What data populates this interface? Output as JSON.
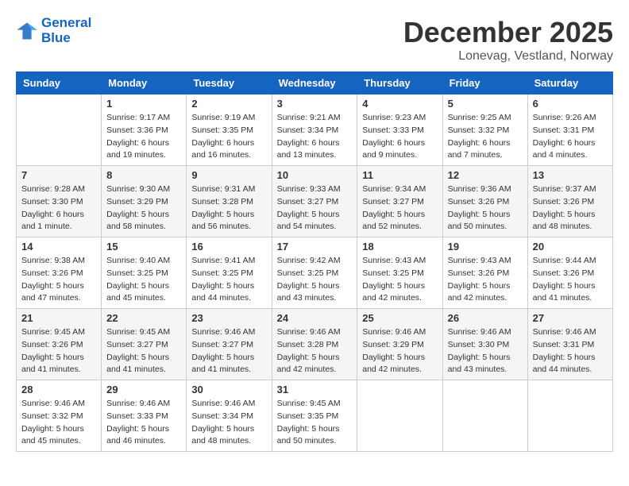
{
  "logo": {
    "line1": "General",
    "line2": "Blue"
  },
  "title": "December 2025",
  "subtitle": "Lonevag, Vestland, Norway",
  "days_header": [
    "Sunday",
    "Monday",
    "Tuesday",
    "Wednesday",
    "Thursday",
    "Friday",
    "Saturday"
  ],
  "weeks": [
    [
      {
        "day": "",
        "sunrise": "",
        "sunset": "",
        "daylight": ""
      },
      {
        "day": "1",
        "sunrise": "Sunrise: 9:17 AM",
        "sunset": "Sunset: 3:36 PM",
        "daylight": "Daylight: 6 hours and 19 minutes."
      },
      {
        "day": "2",
        "sunrise": "Sunrise: 9:19 AM",
        "sunset": "Sunset: 3:35 PM",
        "daylight": "Daylight: 6 hours and 16 minutes."
      },
      {
        "day": "3",
        "sunrise": "Sunrise: 9:21 AM",
        "sunset": "Sunset: 3:34 PM",
        "daylight": "Daylight: 6 hours and 13 minutes."
      },
      {
        "day": "4",
        "sunrise": "Sunrise: 9:23 AM",
        "sunset": "Sunset: 3:33 PM",
        "daylight": "Daylight: 6 hours and 9 minutes."
      },
      {
        "day": "5",
        "sunrise": "Sunrise: 9:25 AM",
        "sunset": "Sunset: 3:32 PM",
        "daylight": "Daylight: 6 hours and 7 minutes."
      },
      {
        "day": "6",
        "sunrise": "Sunrise: 9:26 AM",
        "sunset": "Sunset: 3:31 PM",
        "daylight": "Daylight: 6 hours and 4 minutes."
      }
    ],
    [
      {
        "day": "7",
        "sunrise": "Sunrise: 9:28 AM",
        "sunset": "Sunset: 3:30 PM",
        "daylight": "Daylight: 6 hours and 1 minute."
      },
      {
        "day": "8",
        "sunrise": "Sunrise: 9:30 AM",
        "sunset": "Sunset: 3:29 PM",
        "daylight": "Daylight: 5 hours and 58 minutes."
      },
      {
        "day": "9",
        "sunrise": "Sunrise: 9:31 AM",
        "sunset": "Sunset: 3:28 PM",
        "daylight": "Daylight: 5 hours and 56 minutes."
      },
      {
        "day": "10",
        "sunrise": "Sunrise: 9:33 AM",
        "sunset": "Sunset: 3:27 PM",
        "daylight": "Daylight: 5 hours and 54 minutes."
      },
      {
        "day": "11",
        "sunrise": "Sunrise: 9:34 AM",
        "sunset": "Sunset: 3:27 PM",
        "daylight": "Daylight: 5 hours and 52 minutes."
      },
      {
        "day": "12",
        "sunrise": "Sunrise: 9:36 AM",
        "sunset": "Sunset: 3:26 PM",
        "daylight": "Daylight: 5 hours and 50 minutes."
      },
      {
        "day": "13",
        "sunrise": "Sunrise: 9:37 AM",
        "sunset": "Sunset: 3:26 PM",
        "daylight": "Daylight: 5 hours and 48 minutes."
      }
    ],
    [
      {
        "day": "14",
        "sunrise": "Sunrise: 9:38 AM",
        "sunset": "Sunset: 3:26 PM",
        "daylight": "Daylight: 5 hours and 47 minutes."
      },
      {
        "day": "15",
        "sunrise": "Sunrise: 9:40 AM",
        "sunset": "Sunset: 3:25 PM",
        "daylight": "Daylight: 5 hours and 45 minutes."
      },
      {
        "day": "16",
        "sunrise": "Sunrise: 9:41 AM",
        "sunset": "Sunset: 3:25 PM",
        "daylight": "Daylight: 5 hours and 44 minutes."
      },
      {
        "day": "17",
        "sunrise": "Sunrise: 9:42 AM",
        "sunset": "Sunset: 3:25 PM",
        "daylight": "Daylight: 5 hours and 43 minutes."
      },
      {
        "day": "18",
        "sunrise": "Sunrise: 9:43 AM",
        "sunset": "Sunset: 3:25 PM",
        "daylight": "Daylight: 5 hours and 42 minutes."
      },
      {
        "day": "19",
        "sunrise": "Sunrise: 9:43 AM",
        "sunset": "Sunset: 3:26 PM",
        "daylight": "Daylight: 5 hours and 42 minutes."
      },
      {
        "day": "20",
        "sunrise": "Sunrise: 9:44 AM",
        "sunset": "Sunset: 3:26 PM",
        "daylight": "Daylight: 5 hours and 41 minutes."
      }
    ],
    [
      {
        "day": "21",
        "sunrise": "Sunrise: 9:45 AM",
        "sunset": "Sunset: 3:26 PM",
        "daylight": "Daylight: 5 hours and 41 minutes."
      },
      {
        "day": "22",
        "sunrise": "Sunrise: 9:45 AM",
        "sunset": "Sunset: 3:27 PM",
        "daylight": "Daylight: 5 hours and 41 minutes."
      },
      {
        "day": "23",
        "sunrise": "Sunrise: 9:46 AM",
        "sunset": "Sunset: 3:27 PM",
        "daylight": "Daylight: 5 hours and 41 minutes."
      },
      {
        "day": "24",
        "sunrise": "Sunrise: 9:46 AM",
        "sunset": "Sunset: 3:28 PM",
        "daylight": "Daylight: 5 hours and 42 minutes."
      },
      {
        "day": "25",
        "sunrise": "Sunrise: 9:46 AM",
        "sunset": "Sunset: 3:29 PM",
        "daylight": "Daylight: 5 hours and 42 minutes."
      },
      {
        "day": "26",
        "sunrise": "Sunrise: 9:46 AM",
        "sunset": "Sunset: 3:30 PM",
        "daylight": "Daylight: 5 hours and 43 minutes."
      },
      {
        "day": "27",
        "sunrise": "Sunrise: 9:46 AM",
        "sunset": "Sunset: 3:31 PM",
        "daylight": "Daylight: 5 hours and 44 minutes."
      }
    ],
    [
      {
        "day": "28",
        "sunrise": "Sunrise: 9:46 AM",
        "sunset": "Sunset: 3:32 PM",
        "daylight": "Daylight: 5 hours and 45 minutes."
      },
      {
        "day": "29",
        "sunrise": "Sunrise: 9:46 AM",
        "sunset": "Sunset: 3:33 PM",
        "daylight": "Daylight: 5 hours and 46 minutes."
      },
      {
        "day": "30",
        "sunrise": "Sunrise: 9:46 AM",
        "sunset": "Sunset: 3:34 PM",
        "daylight": "Daylight: 5 hours and 48 minutes."
      },
      {
        "day": "31",
        "sunrise": "Sunrise: 9:45 AM",
        "sunset": "Sunset: 3:35 PM",
        "daylight": "Daylight: 5 hours and 50 minutes."
      },
      {
        "day": "",
        "sunrise": "",
        "sunset": "",
        "daylight": ""
      },
      {
        "day": "",
        "sunrise": "",
        "sunset": "",
        "daylight": ""
      },
      {
        "day": "",
        "sunrise": "",
        "sunset": "",
        "daylight": ""
      }
    ]
  ]
}
